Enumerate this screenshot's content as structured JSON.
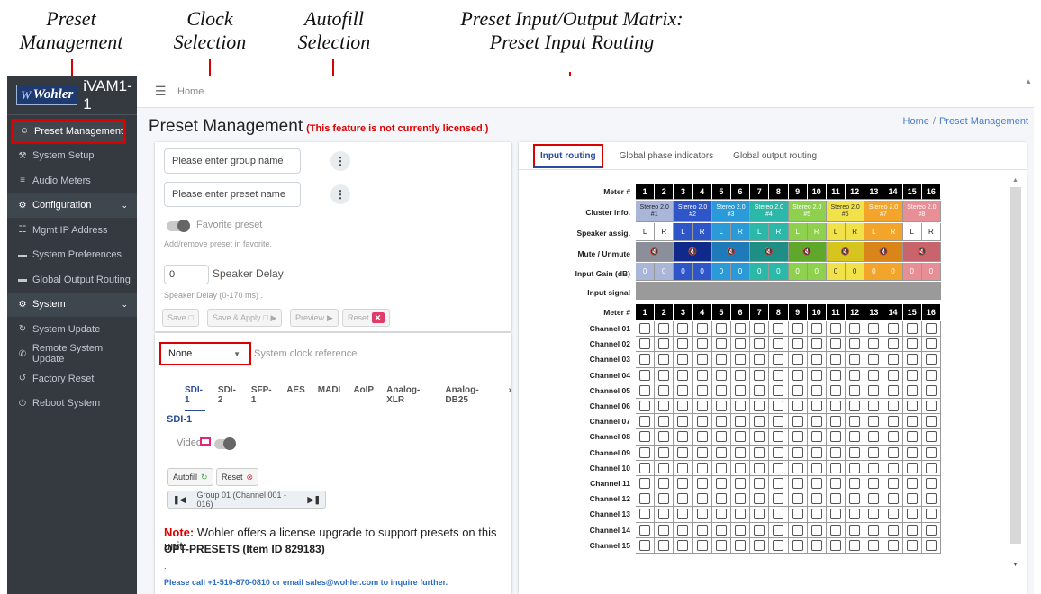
{
  "annotations": {
    "preset_mgmt": "Preset\nManagement",
    "clock": "Clock\nSelection",
    "autofill": "Autofill\nSelection",
    "matrix": "Preset Input/Output Matrix:\nPreset Input Routing"
  },
  "brand": {
    "logo": "Wohler",
    "name": "iVAM1-1"
  },
  "sidebar": {
    "items": [
      {
        "label": "Preset Management",
        "icon": "users-cog-icon",
        "glyph": "☺",
        "active": true
      },
      {
        "label": "System Setup",
        "icon": "tools-icon",
        "glyph": "⚒"
      },
      {
        "label": "Audio Meters",
        "icon": "chart-icon",
        "glyph": "≡"
      },
      {
        "label": "Configuration",
        "icon": "gear-icon",
        "glyph": "⚙",
        "group": true
      },
      {
        "label": "Mgmt IP Address",
        "icon": "network-icon",
        "glyph": "☷"
      },
      {
        "label": "System Preferences",
        "icon": "ethernet-icon",
        "glyph": "▬"
      },
      {
        "label": "Global Output Routing",
        "icon": "ethernet-icon",
        "glyph": "▬"
      },
      {
        "label": "System",
        "icon": "gears-icon",
        "glyph": "⚙",
        "group": true
      },
      {
        "label": "System Update",
        "icon": "sync-icon",
        "glyph": "↻"
      },
      {
        "label": "Remote System Update",
        "icon": "satellite-icon",
        "glyph": "✆"
      },
      {
        "label": "Factory Reset",
        "icon": "undo-icon",
        "glyph": "↺"
      },
      {
        "label": "Reboot System",
        "icon": "power-icon",
        "glyph": "⏻"
      }
    ]
  },
  "topbar": {
    "home": "Home"
  },
  "header": {
    "title": "Preset Management",
    "warning": "(This feature is not currently licensed.)",
    "breadcrumb": {
      "home": "Home",
      "sep": "/",
      "current": "Preset Management"
    }
  },
  "preset_form": {
    "group_placeholder": "Please enter group name",
    "preset_placeholder": "Please enter preset name",
    "favorite_label": "Favorite preset",
    "favorite_help": "Add/remove preset in favorite.",
    "speaker_delay_value": "0",
    "speaker_delay_label": "Speaker Delay",
    "speaker_delay_help": "Speaker Delay (0-170 ms) .",
    "save": "Save",
    "save_apply": "Save & Apply",
    "preview": "Preview",
    "reset": "Reset"
  },
  "clock": {
    "selected": "None",
    "label": "System clock reference"
  },
  "input_tabs": [
    "SDI-1",
    "SDI-2",
    "SFP-1",
    "AES",
    "MADI",
    "AoIP",
    "Analog-XLR",
    "Analog-DB25"
  ],
  "input_panel": {
    "title": "SDI-1",
    "video_label": "Video",
    "autofill": "Autofill",
    "reset": "Reset",
    "group_nav": "Group 01 (Channel 001 - 016)"
  },
  "license_note": {
    "prefix": "Note:",
    "text": "Wohler offers a license upgrade to support presets on this unit:",
    "product": "OPT-PRESETS (Item ID 829183)",
    "dot": ".",
    "contact": "Please call +1-510-870-0810 or email sales@wohler.com to inquire further."
  },
  "right_tabs": [
    "Input routing",
    "Global phase indicators",
    "Global output routing"
  ],
  "matrix": {
    "labels": {
      "meter": "Meter #",
      "cluster": "Cluster info.",
      "speaker": "Speaker assig.",
      "mute": "Mute / Unmute",
      "gain": "Input Gain (dB)",
      "signal": "Input signal"
    },
    "meters": [
      "1",
      "2",
      "3",
      "4",
      "5",
      "6",
      "7",
      "8",
      "9",
      "10",
      "11",
      "12",
      "13",
      "14",
      "15",
      "16"
    ],
    "clusters": [
      {
        "label": "Stereo 2.0",
        "num": "#1",
        "color": "#a9b6d8",
        "text": "#223"
      },
      {
        "label": "Stereo 2.0",
        "num": "#2",
        "color": "#2f56c9",
        "text": "#fff"
      },
      {
        "label": "Stereo 2.0",
        "num": "#3",
        "color": "#2a9ad8",
        "text": "#fff"
      },
      {
        "label": "Stereo 2.0",
        "num": "#4",
        "color": "#2cb8a8",
        "text": "#fff"
      },
      {
        "label": "Stereo 2.0",
        "num": "#5",
        "color": "#8fd14f",
        "text": "#fff"
      },
      {
        "label": "Stereo 2.0",
        "num": "#6",
        "color": "#f2e24a",
        "text": "#333"
      },
      {
        "label": "Stereo 2.0",
        "num": "#7",
        "color": "#f2a52a",
        "text": "#fff"
      },
      {
        "label": "Stereo 2.0",
        "num": "#8",
        "color": "#e88f95",
        "text": "#fff"
      }
    ],
    "speakers": [
      "L",
      "R",
      "L",
      "R",
      "L",
      "R",
      "L",
      "R",
      "L",
      "R",
      "L",
      "R",
      "L",
      "R",
      "L",
      "R"
    ],
    "mute_colors": [
      "#8a8f99",
      "#0f2a8a",
      "#1e7ab8",
      "#1f8f85",
      "#5fa82b",
      "#d6c51f",
      "#d9851a",
      "#c8646b"
    ],
    "gains": [
      "0",
      "0",
      "0",
      "0",
      "0",
      "0",
      "0",
      "0",
      "0",
      "0",
      "0",
      "0",
      "0",
      "0",
      "0",
      "0"
    ],
    "channels": [
      "Channel 01",
      "Channel 02",
      "Channel 03",
      "Channel 04",
      "Channel 05",
      "Channel 06",
      "Channel 07",
      "Channel 08",
      "Channel 09",
      "Channel 10",
      "Channel 11",
      "Channel 12",
      "Channel 13",
      "Channel 14",
      "Channel 15"
    ]
  }
}
